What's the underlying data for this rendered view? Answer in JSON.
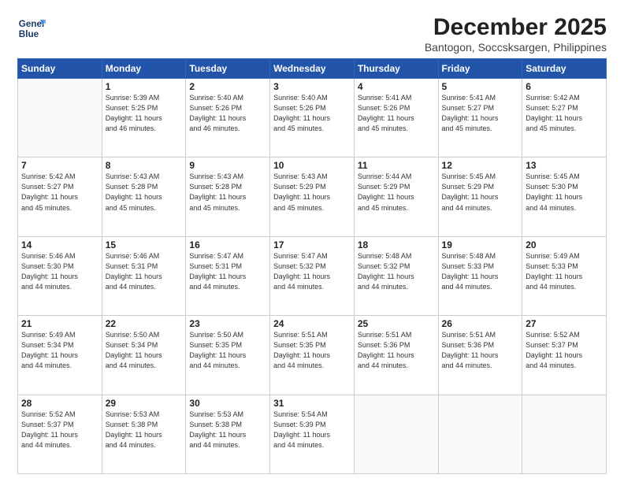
{
  "logo": {
    "line1": "General",
    "line2": "Blue"
  },
  "title": "December 2025",
  "location": "Bantogon, Soccsksargen, Philippines",
  "days_of_week": [
    "Sunday",
    "Monday",
    "Tuesday",
    "Wednesday",
    "Thursday",
    "Friday",
    "Saturday"
  ],
  "weeks": [
    [
      {
        "day": "",
        "info": ""
      },
      {
        "day": "1",
        "info": "Sunrise: 5:39 AM\nSunset: 5:25 PM\nDaylight: 11 hours\nand 46 minutes."
      },
      {
        "day": "2",
        "info": "Sunrise: 5:40 AM\nSunset: 5:26 PM\nDaylight: 11 hours\nand 46 minutes."
      },
      {
        "day": "3",
        "info": "Sunrise: 5:40 AM\nSunset: 5:26 PM\nDaylight: 11 hours\nand 45 minutes."
      },
      {
        "day": "4",
        "info": "Sunrise: 5:41 AM\nSunset: 5:26 PM\nDaylight: 11 hours\nand 45 minutes."
      },
      {
        "day": "5",
        "info": "Sunrise: 5:41 AM\nSunset: 5:27 PM\nDaylight: 11 hours\nand 45 minutes."
      },
      {
        "day": "6",
        "info": "Sunrise: 5:42 AM\nSunset: 5:27 PM\nDaylight: 11 hours\nand 45 minutes."
      }
    ],
    [
      {
        "day": "7",
        "info": "Sunrise: 5:42 AM\nSunset: 5:27 PM\nDaylight: 11 hours\nand 45 minutes."
      },
      {
        "day": "8",
        "info": "Sunrise: 5:43 AM\nSunset: 5:28 PM\nDaylight: 11 hours\nand 45 minutes."
      },
      {
        "day": "9",
        "info": "Sunrise: 5:43 AM\nSunset: 5:28 PM\nDaylight: 11 hours\nand 45 minutes."
      },
      {
        "day": "10",
        "info": "Sunrise: 5:43 AM\nSunset: 5:29 PM\nDaylight: 11 hours\nand 45 minutes."
      },
      {
        "day": "11",
        "info": "Sunrise: 5:44 AM\nSunset: 5:29 PM\nDaylight: 11 hours\nand 45 minutes."
      },
      {
        "day": "12",
        "info": "Sunrise: 5:45 AM\nSunset: 5:29 PM\nDaylight: 11 hours\nand 44 minutes."
      },
      {
        "day": "13",
        "info": "Sunrise: 5:45 AM\nSunset: 5:30 PM\nDaylight: 11 hours\nand 44 minutes."
      }
    ],
    [
      {
        "day": "14",
        "info": "Sunrise: 5:46 AM\nSunset: 5:30 PM\nDaylight: 11 hours\nand 44 minutes."
      },
      {
        "day": "15",
        "info": "Sunrise: 5:46 AM\nSunset: 5:31 PM\nDaylight: 11 hours\nand 44 minutes."
      },
      {
        "day": "16",
        "info": "Sunrise: 5:47 AM\nSunset: 5:31 PM\nDaylight: 11 hours\nand 44 minutes."
      },
      {
        "day": "17",
        "info": "Sunrise: 5:47 AM\nSunset: 5:32 PM\nDaylight: 11 hours\nand 44 minutes."
      },
      {
        "day": "18",
        "info": "Sunrise: 5:48 AM\nSunset: 5:32 PM\nDaylight: 11 hours\nand 44 minutes."
      },
      {
        "day": "19",
        "info": "Sunrise: 5:48 AM\nSunset: 5:33 PM\nDaylight: 11 hours\nand 44 minutes."
      },
      {
        "day": "20",
        "info": "Sunrise: 5:49 AM\nSunset: 5:33 PM\nDaylight: 11 hours\nand 44 minutes."
      }
    ],
    [
      {
        "day": "21",
        "info": "Sunrise: 5:49 AM\nSunset: 5:34 PM\nDaylight: 11 hours\nand 44 minutes."
      },
      {
        "day": "22",
        "info": "Sunrise: 5:50 AM\nSunset: 5:34 PM\nDaylight: 11 hours\nand 44 minutes."
      },
      {
        "day": "23",
        "info": "Sunrise: 5:50 AM\nSunset: 5:35 PM\nDaylight: 11 hours\nand 44 minutes."
      },
      {
        "day": "24",
        "info": "Sunrise: 5:51 AM\nSunset: 5:35 PM\nDaylight: 11 hours\nand 44 minutes."
      },
      {
        "day": "25",
        "info": "Sunrise: 5:51 AM\nSunset: 5:36 PM\nDaylight: 11 hours\nand 44 minutes."
      },
      {
        "day": "26",
        "info": "Sunrise: 5:51 AM\nSunset: 5:36 PM\nDaylight: 11 hours\nand 44 minutes."
      },
      {
        "day": "27",
        "info": "Sunrise: 5:52 AM\nSunset: 5:37 PM\nDaylight: 11 hours\nand 44 minutes."
      }
    ],
    [
      {
        "day": "28",
        "info": "Sunrise: 5:52 AM\nSunset: 5:37 PM\nDaylight: 11 hours\nand 44 minutes."
      },
      {
        "day": "29",
        "info": "Sunrise: 5:53 AM\nSunset: 5:38 PM\nDaylight: 11 hours\nand 44 minutes."
      },
      {
        "day": "30",
        "info": "Sunrise: 5:53 AM\nSunset: 5:38 PM\nDaylight: 11 hours\nand 44 minutes."
      },
      {
        "day": "31",
        "info": "Sunrise: 5:54 AM\nSunset: 5:39 PM\nDaylight: 11 hours\nand 44 minutes."
      },
      {
        "day": "",
        "info": ""
      },
      {
        "day": "",
        "info": ""
      },
      {
        "day": "",
        "info": ""
      }
    ]
  ]
}
